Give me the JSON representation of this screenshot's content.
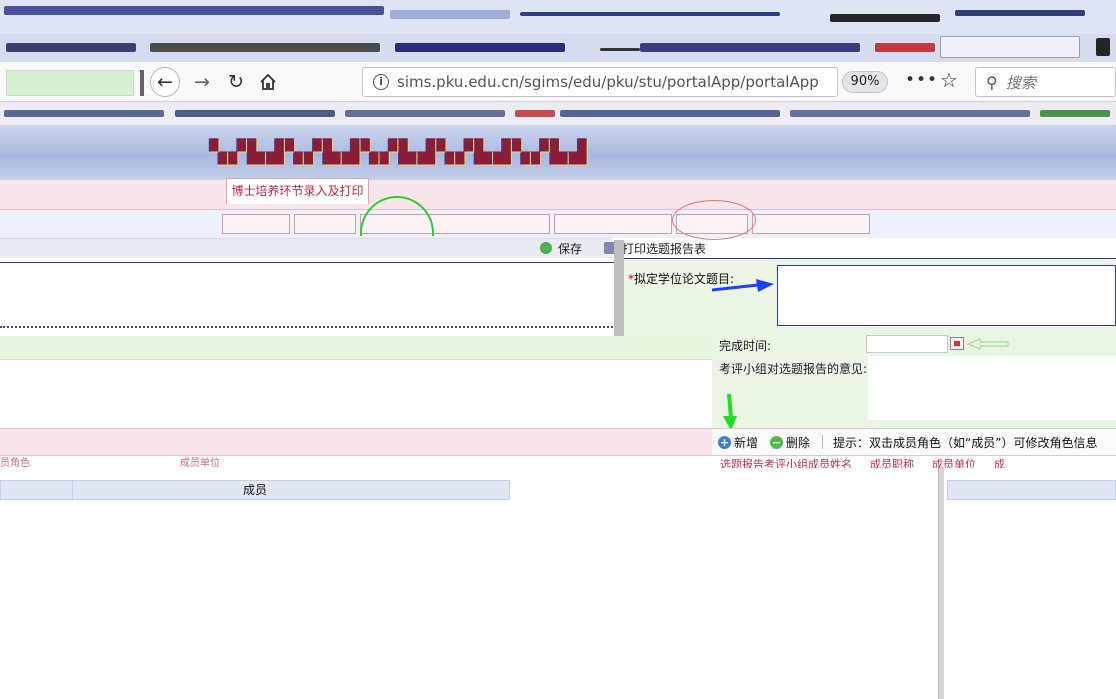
{
  "browser": {
    "url": "sims.pku.edu.cn/sgims/edu/pku/stu/portalApp/portalApp",
    "zoom": "90%",
    "search_placeholder": "搜索"
  },
  "page": {
    "module_tab": "博士培养环节录入及打印"
  },
  "toolbar": {
    "save_label": "保存",
    "print_label": "打印选题报告表"
  },
  "form": {
    "thesis_title_required_mark": "*",
    "thesis_title_label": "拟定学位论文题目:",
    "completion_time_label": "完成时间:",
    "committee_opinion_label": "考评小组对选题报告的意见:"
  },
  "committee": {
    "add_label": "新增",
    "delete_label": "删除",
    "hint": "提示：双击成员角色（如“成员”）可修改角色信息",
    "columns": [
      "选题报告考评小组成员姓名",
      "成员职称",
      "成员单位",
      "成"
    ],
    "left_columns": [
      "员角色",
      "成员单位"
    ],
    "rows": [
      {
        "role": "成员"
      }
    ]
  },
  "colors": {
    "accent_red": "#b8254f",
    "panel_green": "#eaf5e4",
    "border_blue": "#2b3bbd",
    "annotation_green": "#2ecc2e",
    "annotation_blue": "#1f3fff"
  }
}
